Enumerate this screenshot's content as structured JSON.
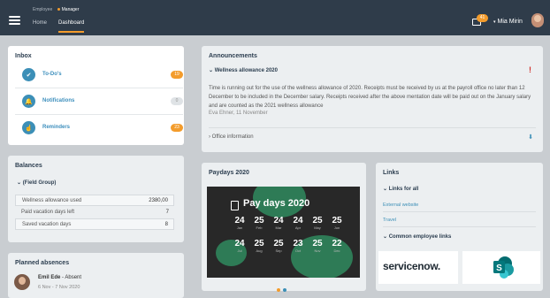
{
  "header": {
    "roles": [
      "Employee",
      "Manager"
    ],
    "tabs": [
      "Home",
      "Dashboard"
    ],
    "notification_count": "41",
    "user_name": "Mia Mirin"
  },
  "inbox": {
    "title": "Inbox",
    "items": [
      {
        "label": "To-Do's",
        "count": "19",
        "icon": "checkbox-icon"
      },
      {
        "label": "Notifications",
        "count": "0",
        "icon": "bell-icon"
      },
      {
        "label": "Reminders",
        "count": "23",
        "icon": "hand-pointer-icon"
      }
    ]
  },
  "balances": {
    "title": "Balances",
    "group": "(Field Group)",
    "rows": [
      {
        "label": "Wellness allowance used",
        "value": "2380,00"
      },
      {
        "label": "Paid vacation days left",
        "value": "7"
      },
      {
        "label": "Saved vacation days",
        "value": "8"
      }
    ]
  },
  "absences": {
    "title": "Planned absences",
    "name": "Emil Ede",
    "status": "- Absent",
    "dates": "6 Nov - 7 Nov 2020"
  },
  "announcements": {
    "title": "Announcements",
    "item_title": "Wellness allowance 2020",
    "body": "Time is running out for the use of the wellness allowance of 2020. Receipts must be received by us at the payroll office no later than 12 December to be included in the December salary. Receipts received after the above mentation date will be paid out on the January salary and are counted as the 2021 wellness allowance",
    "author": "Eva Ehner, 11 November",
    "item2": "Office information"
  },
  "paydays": {
    "title": "Paydays 2020",
    "banner_title": "Pay days 2020",
    "row1": [
      {
        "day": "24",
        "month": "Jan"
      },
      {
        "day": "25",
        "month": "Feb"
      },
      {
        "day": "24",
        "month": "Mar"
      },
      {
        "day": "24",
        "month": "Apr"
      },
      {
        "day": "25",
        "month": "May"
      },
      {
        "day": "25",
        "month": "Jun"
      }
    ],
    "row2": [
      {
        "day": "24",
        "month": "Jul"
      },
      {
        "day": "25",
        "month": "Aug"
      },
      {
        "day": "25",
        "month": "Sep"
      },
      {
        "day": "23",
        "month": "Oct"
      },
      {
        "day": "25",
        "month": "Nov"
      },
      {
        "day": "22",
        "month": "Dec"
      }
    ]
  },
  "links": {
    "title": "Links",
    "section1": "Links for all",
    "external": "External website",
    "travel": "Travel",
    "section2": "Common employee links",
    "servicenow": "servicenow."
  },
  "colors": {
    "topbar": "#2f3c4a",
    "accent": "#f39c2c",
    "link_blue": "#3c8fb7",
    "alert_red": "#d0312d"
  }
}
